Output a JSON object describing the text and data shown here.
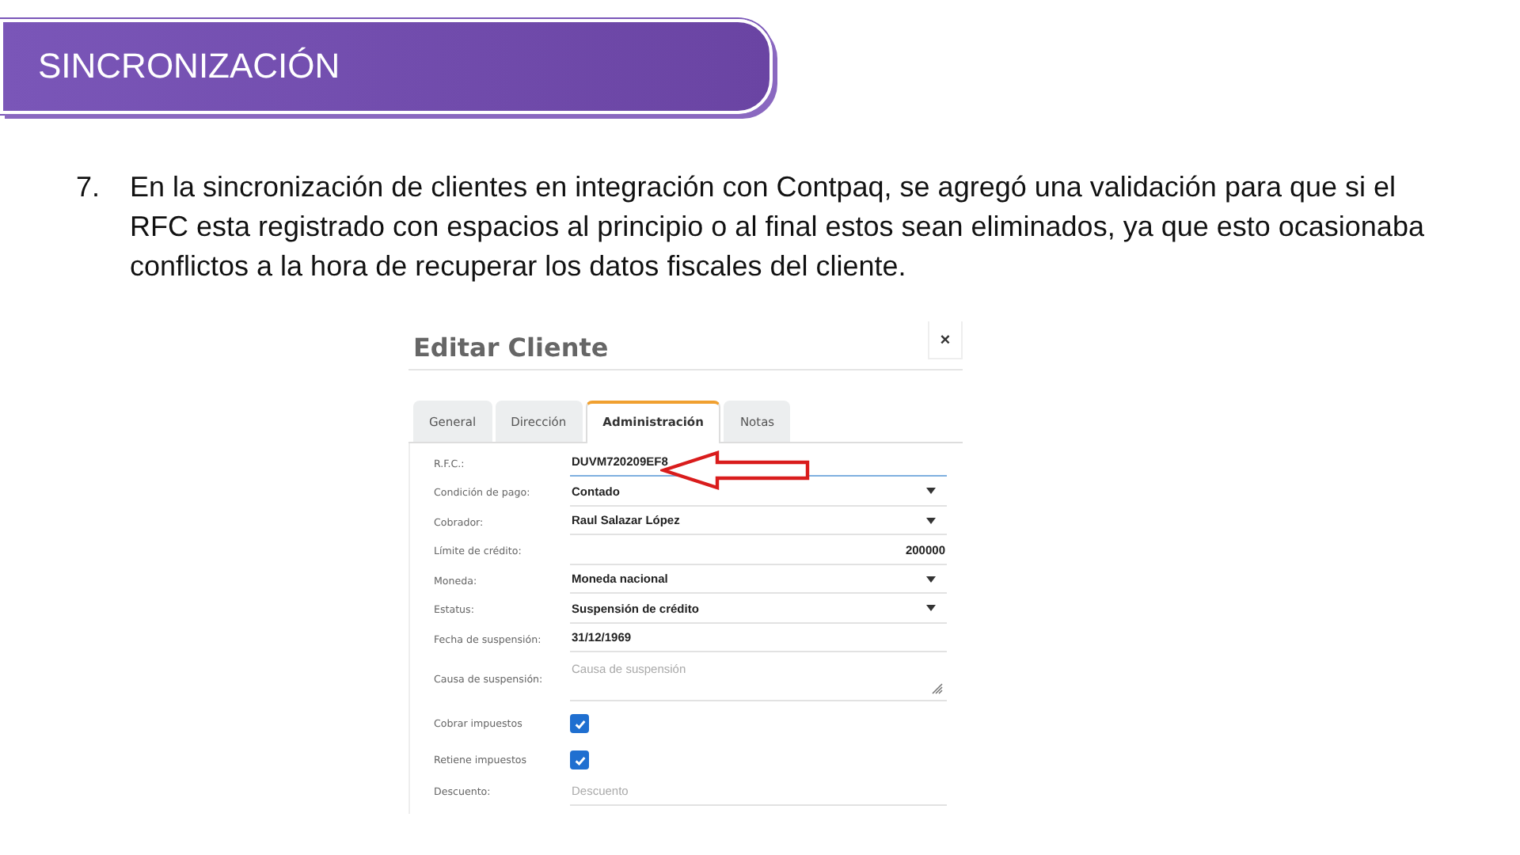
{
  "header": {
    "title": "SINCRONIZACIÓN"
  },
  "paragraph": {
    "number": "7.",
    "text": "En la sincronización de clientes en integración con Contpaq, se agregó una validación para que si el RFC esta registrado con espacios al principio o al final estos sean eliminados, ya que esto ocasionaba conflictos a la hora de recuperar los datos fiscales del cliente."
  },
  "dialog": {
    "title": "Editar Cliente",
    "close": "×",
    "tabs": [
      {
        "label": "General",
        "selected": false
      },
      {
        "label": "Dirección",
        "selected": false
      },
      {
        "label": "Administración",
        "selected": true
      },
      {
        "label": "Notas",
        "selected": false
      }
    ],
    "fields": [
      {
        "kind": "text",
        "label": "R.F.C.:",
        "value": "DUVM720209EF8",
        "focused": true
      },
      {
        "kind": "select",
        "label": "Condición de pago:",
        "value": "Contado"
      },
      {
        "kind": "select",
        "label": "Cobrador:",
        "value": "Raul Salazar López"
      },
      {
        "kind": "number",
        "label": "Límite de crédito:",
        "value": "200000"
      },
      {
        "kind": "select",
        "label": "Moneda:",
        "value": "Moneda nacional"
      },
      {
        "kind": "select",
        "label": "Estatus:",
        "value": "Suspensión de crédito"
      },
      {
        "kind": "text",
        "label": "Fecha de suspensión:",
        "value": "31/12/1969",
        "focused": false
      },
      {
        "kind": "textarea",
        "label": "Causa de suspensión:",
        "placeholder": "Causa de suspensión"
      },
      {
        "kind": "checkbox",
        "label": "Cobrar impuestos",
        "checked": true
      },
      {
        "kind": "checkbox",
        "label": "Retiene impuestos",
        "checked": true
      },
      {
        "kind": "text",
        "label": "Descuento:",
        "placeholder": "Descuento",
        "focused": false
      }
    ]
  }
}
